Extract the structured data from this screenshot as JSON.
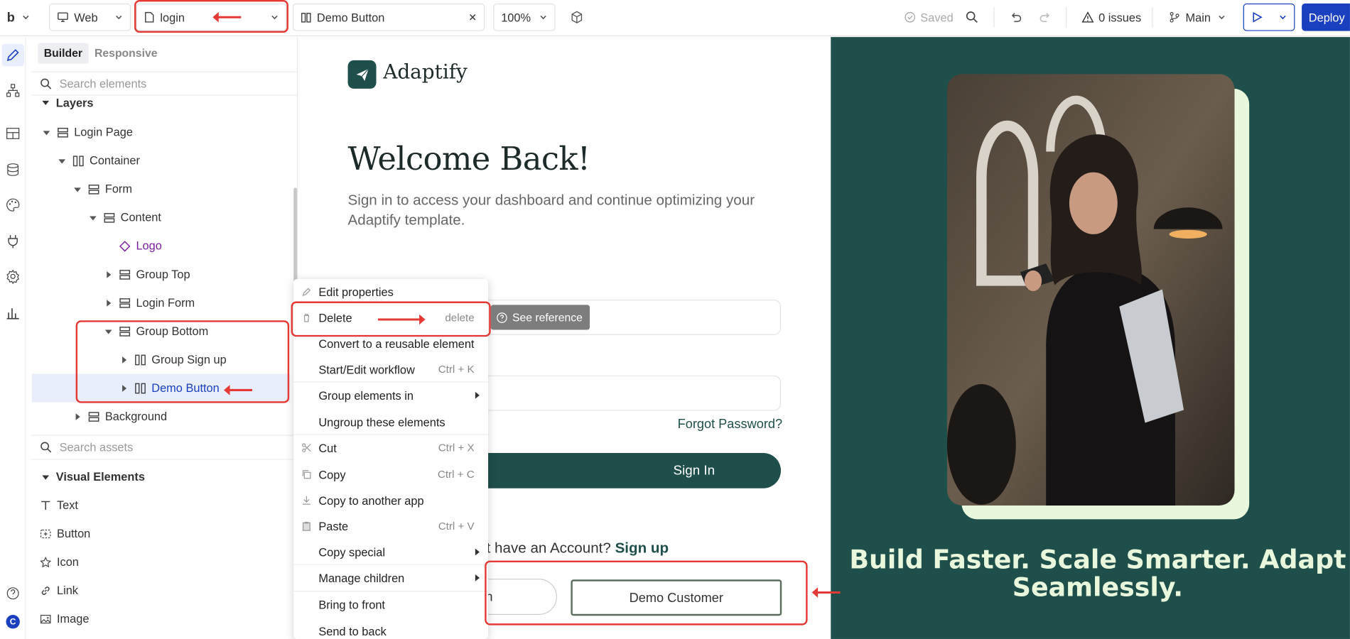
{
  "topbar": {
    "logo": "b",
    "platform": "Web",
    "page": "login",
    "element_tab": "Demo Button",
    "zoom": "100%",
    "saved": "Saved",
    "issues": "0 issues",
    "branch": "Main",
    "deploy": "Deploy"
  },
  "rail": {
    "icons": [
      "pencil-icon",
      "hierarchy-icon",
      "layout-icon",
      "database-icon",
      "palette-icon",
      "plug-icon",
      "settings-icon",
      "chart-icon",
      "help-icon"
    ],
    "avatar": "C"
  },
  "panel": {
    "tabs": [
      "Builder",
      "Responsive"
    ],
    "search_elements": "Search elements",
    "layers_label": "Layers",
    "tree": [
      {
        "label": "Login Page",
        "depth": 0,
        "caret": "down",
        "icon": "stack"
      },
      {
        "label": "Container",
        "depth": 1,
        "caret": "down",
        "icon": "columns"
      },
      {
        "label": "Form",
        "depth": 2,
        "caret": "down",
        "icon": "stack"
      },
      {
        "label": "Content",
        "depth": 3,
        "caret": "down",
        "icon": "stack"
      },
      {
        "label": "Logo",
        "depth": 4,
        "caret": "none",
        "icon": "diamond"
      },
      {
        "label": "Group Top",
        "depth": 4,
        "caret": "right",
        "icon": "stack"
      },
      {
        "label": "Login Form",
        "depth": 4,
        "caret": "right",
        "icon": "stack"
      },
      {
        "label": "Group Bottom",
        "depth": 4,
        "caret": "down",
        "icon": "stack"
      },
      {
        "label": "Group Sign up",
        "depth": 5,
        "caret": "right",
        "icon": "columns"
      },
      {
        "label": "Demo Button",
        "depth": 5,
        "caret": "right",
        "icon": "columns",
        "selected": true
      },
      {
        "label": "Background",
        "depth": 2,
        "caret": "right",
        "icon": "stack"
      }
    ],
    "search_assets": "Search assets",
    "visual_elements_label": "Visual Elements",
    "visual_elements": [
      {
        "label": "Text",
        "icon": "text-icon"
      },
      {
        "label": "Button",
        "icon": "button-icon"
      },
      {
        "label": "Icon",
        "icon": "star-icon"
      },
      {
        "label": "Link",
        "icon": "link-icon"
      },
      {
        "label": "Image",
        "icon": "image-icon"
      }
    ]
  },
  "context_menu": {
    "items": [
      {
        "label": "Edit properties",
        "shortcut": "",
        "submenu": false,
        "icon": "edit-icon",
        "sep_before": false
      },
      {
        "label": "Delete",
        "shortcut": "delete",
        "submenu": false,
        "icon": "trash-icon",
        "sep_before": false
      },
      {
        "label": "Convert to a reusable element",
        "shortcut": "",
        "submenu": false,
        "icon": "",
        "sep_before": false
      },
      {
        "label": "Start/Edit workflow",
        "shortcut": "Ctrl + K",
        "submenu": false,
        "icon": "",
        "sep_before": false
      },
      {
        "label": "Group elements in",
        "shortcut": "",
        "submenu": true,
        "icon": "",
        "sep_before": true
      },
      {
        "label": "Ungroup these elements",
        "shortcut": "",
        "submenu": false,
        "icon": "",
        "sep_before": false
      },
      {
        "label": "Cut",
        "shortcut": "Ctrl + X",
        "submenu": false,
        "icon": "scissors-icon",
        "sep_before": true
      },
      {
        "label": "Copy",
        "shortcut": "Ctrl + C",
        "submenu": false,
        "icon": "copy-icon",
        "sep_before": false
      },
      {
        "label": "Copy to another app",
        "shortcut": "",
        "submenu": false,
        "icon": "download-icon",
        "sep_before": false
      },
      {
        "label": "Paste",
        "shortcut": "Ctrl + V",
        "submenu": false,
        "icon": "paste-icon",
        "sep_before": false
      },
      {
        "label": "Copy special",
        "shortcut": "",
        "submenu": true,
        "icon": "",
        "sep_before": false
      },
      {
        "label": "Manage children",
        "shortcut": "",
        "submenu": true,
        "icon": "",
        "sep_before": true
      },
      {
        "label": "Bring to front",
        "shortcut": "",
        "submenu": false,
        "icon": "",
        "sep_before": true
      },
      {
        "label": "Send to back",
        "shortcut": "",
        "submenu": false,
        "icon": "",
        "sep_before": false
      }
    ],
    "see_reference": "See reference"
  },
  "canvas": {
    "brand": "Adaptify",
    "heading": "Welcome Back!",
    "subtitle": "Sign in to access your dashboard and continue optimizing your Adaptify template.",
    "forgot": "Forgot Password?",
    "sign_in": "Sign In",
    "no_account": "t have an Account?",
    "sign_up": "Sign up",
    "demo_left_fragment": "n",
    "demo_customer": "Demo Customer"
  },
  "hero": {
    "tagline": "Build Faster. Scale Smarter. Adapt Seamlessly."
  },
  "colors": {
    "accent_blue": "#1a3fbf",
    "brand_green": "#1f4f4b",
    "annotation_red": "#e53935",
    "selected_row": "#e8eefb",
    "hero_text": "#e9f7dc"
  }
}
